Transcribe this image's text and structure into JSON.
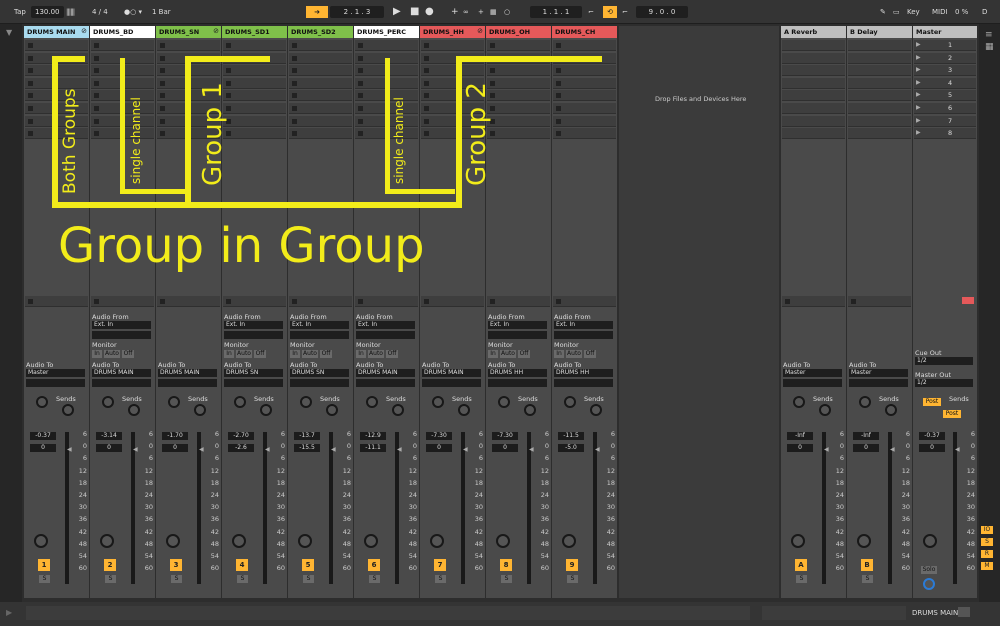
{
  "transport": {
    "tap": "Tap",
    "tempo": "130.00",
    "time_sig": "4 / 4",
    "metronome": "1 Bar",
    "position": "2 . 1 . 3",
    "loop_start": "1 . 1 . 1",
    "loop_length": "9 . 0 . 0",
    "key": "Key",
    "midi": "MIDI",
    "cpu": "0 %",
    "d": "D"
  },
  "tracks": [
    {
      "name": "DRUMS MAIN",
      "color": "#a9dbef",
      "vol": "-0.37",
      "pan": "0",
      "num": "1",
      "route": "Master",
      "group": true
    },
    {
      "name": "DRUMS_BD",
      "color": "#ffffff",
      "vol": "-3.14",
      "pan": "0",
      "num": "2",
      "route": "DRUMS MAIN",
      "input": true
    },
    {
      "name": "DRUMS_SN",
      "color": "#7fc04a",
      "vol": "-1.70",
      "pan": "0",
      "num": "3",
      "route": "DRUMS MAIN",
      "group": true
    },
    {
      "name": "DRUMS_SD1",
      "color": "#7fc04a",
      "vol": "-2.70",
      "pan": "-2.6",
      "num": "4",
      "route": "DRUMS SN",
      "input": true
    },
    {
      "name": "DRUMS_SD2",
      "color": "#7fc04a",
      "vol": "-13.7",
      "pan": "-15.5",
      "num": "5",
      "route": "DRUMS SN",
      "input": true
    },
    {
      "name": "DRUMS_PERC",
      "color": "#ffffff",
      "vol": "-12.9",
      "pan": "-11.1",
      "num": "6",
      "route": "DRUMS MAIN",
      "input": true
    },
    {
      "name": "DRUMS_HH",
      "color": "#e5595a",
      "vol": "-7.30",
      "pan": "0",
      "num": "7",
      "route": "DRUMS MAIN",
      "group": true
    },
    {
      "name": "DRUMS_OH",
      "color": "#e5595a",
      "vol": "-7.30",
      "pan": "0",
      "num": "8",
      "route": "DRUMS HH",
      "input": true
    },
    {
      "name": "DRUMS_CH",
      "color": "#e5595a",
      "vol": "-11.5",
      "pan": "-5.0",
      "num": "9",
      "route": "DRUMS HH",
      "input": true
    }
  ],
  "returns": [
    {
      "name": "A Reverb",
      "vol": "-Inf",
      "pan": "0",
      "num": "A",
      "route": "Master"
    },
    {
      "name": "B Delay",
      "vol": "-Inf",
      "pan": "0",
      "num": "B",
      "route": "Master"
    }
  ],
  "master": {
    "name": "Master",
    "vol": "-0.37",
    "pan": "0",
    "scenes": [
      "1",
      "2",
      "3",
      "4",
      "5",
      "6",
      "7",
      "8"
    ],
    "cue_out_label": "Cue Out",
    "cue_out": "1/2",
    "master_out_label": "Master Out",
    "master_out": "1/2",
    "post": "Post",
    "solo": "Solo"
  },
  "labels": {
    "audio_from": "Audio From",
    "ext_in": "Ext. In",
    "monitor": "Monitor",
    "mon_in": "In",
    "mon_auto": "Auto",
    "mon_off": "Off",
    "audio_to": "Audio To",
    "sends": "Sends",
    "solo": "S",
    "drop_hint": "Drop Files and Devices Here",
    "ticks": [
      "6",
      "0",
      "6",
      "12",
      "18",
      "24",
      "30",
      "36",
      "42",
      "48",
      "54",
      "60"
    ]
  },
  "annotations": {
    "both_groups": "Both Groups",
    "single_channel_1": "single channel",
    "group_1": "Group 1",
    "single_channel_2": "single channel",
    "group_2": "Group 2",
    "group_in_group": "Group in Group"
  },
  "bottom": {
    "selected_track": "DRUMS MAIN"
  }
}
